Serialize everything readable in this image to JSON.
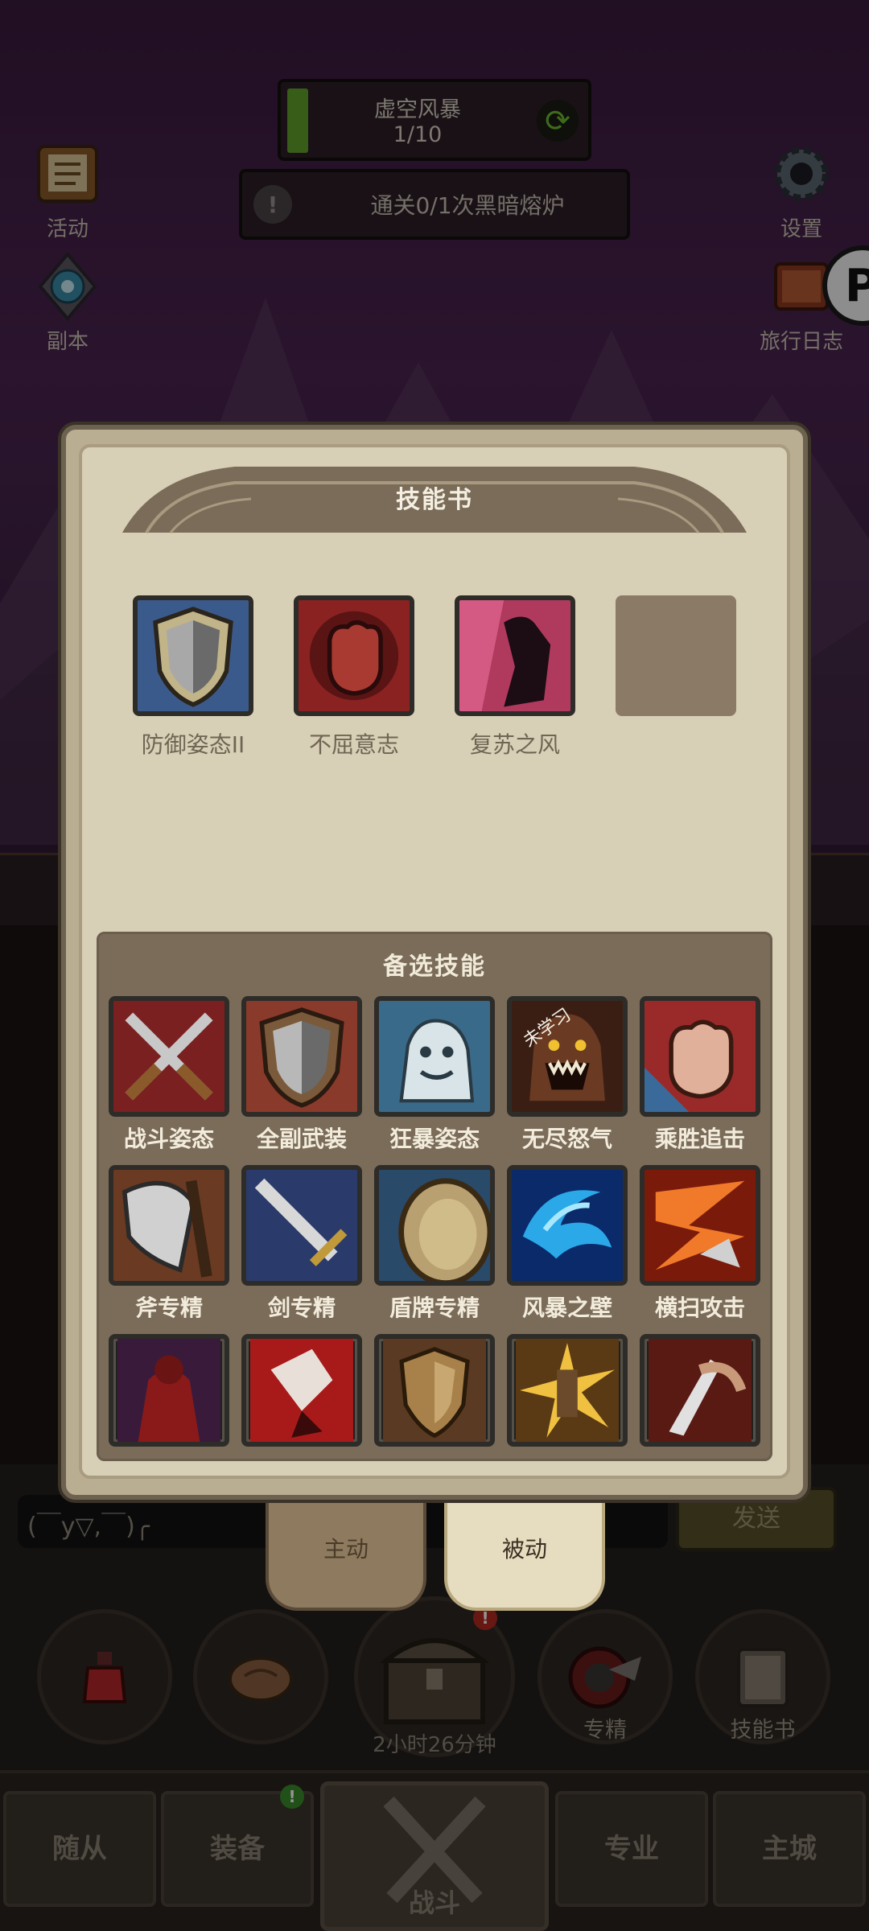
{
  "hud": {
    "quest": {
      "title": "虚空风暴",
      "progress": "1/10"
    },
    "task": {
      "text": "通关0/1次黑暗熔炉"
    }
  },
  "side_buttons": {
    "events": "活动",
    "dungeon": "副本",
    "settings": "设置",
    "journal": "旅行日志"
  },
  "panel": {
    "title": "技能书",
    "equipped": [
      {
        "label": "防御姿态II",
        "icon": "shield-icon"
      },
      {
        "label": "不屈意志",
        "icon": "fist-icon"
      },
      {
        "label": "复苏之风",
        "icon": "warrior-silhouette-icon"
      }
    ],
    "alternate_title": "备选技能",
    "alternate": [
      {
        "label": "战斗姿态",
        "icon": "crossed-swords-icon"
      },
      {
        "label": "全副武装",
        "icon": "shield-icon"
      },
      {
        "label": "狂暴姿态",
        "icon": "berserker-icon"
      },
      {
        "label": "无尽怒气",
        "icon": "roaring-beast-icon",
        "badge": "未学习"
      },
      {
        "label": "乘胜追击",
        "icon": "fist-icon"
      },
      {
        "label": "斧专精",
        "icon": "axe-icon"
      },
      {
        "label": "剑专精",
        "icon": "sword-icon"
      },
      {
        "label": "盾牌专精",
        "icon": "round-shield-icon"
      },
      {
        "label": "风暴之壁",
        "icon": "blue-vortex-icon"
      },
      {
        "label": "横扫攻击",
        "icon": "sweep-slash-icon"
      },
      {
        "label": "",
        "icon": "red-figure-icon"
      },
      {
        "label": "",
        "icon": "blood-strike-icon"
      },
      {
        "label": "",
        "icon": "kite-shield-icon"
      },
      {
        "label": "",
        "icon": "burst-icon"
      },
      {
        "label": "",
        "icon": "bleed-slash-icon"
      }
    ]
  },
  "chat": {
    "text": "(￣y▽,￣)╭",
    "send": "发送"
  },
  "skill_tabs": {
    "active": "主动",
    "passive": "被动"
  },
  "actions": {
    "specialization": "专精",
    "skill_book": "技能书",
    "chest_timer": "2小时26分钟"
  },
  "nav": {
    "followers": "随从",
    "equipment": "装备",
    "battle": "战斗",
    "profession": "专业",
    "main_city": "主城"
  },
  "colors": {
    "accent_green": "#5fa02a",
    "panel_parchment": "#d8cfb7",
    "alt_panel_brown": "#7a6c59"
  }
}
